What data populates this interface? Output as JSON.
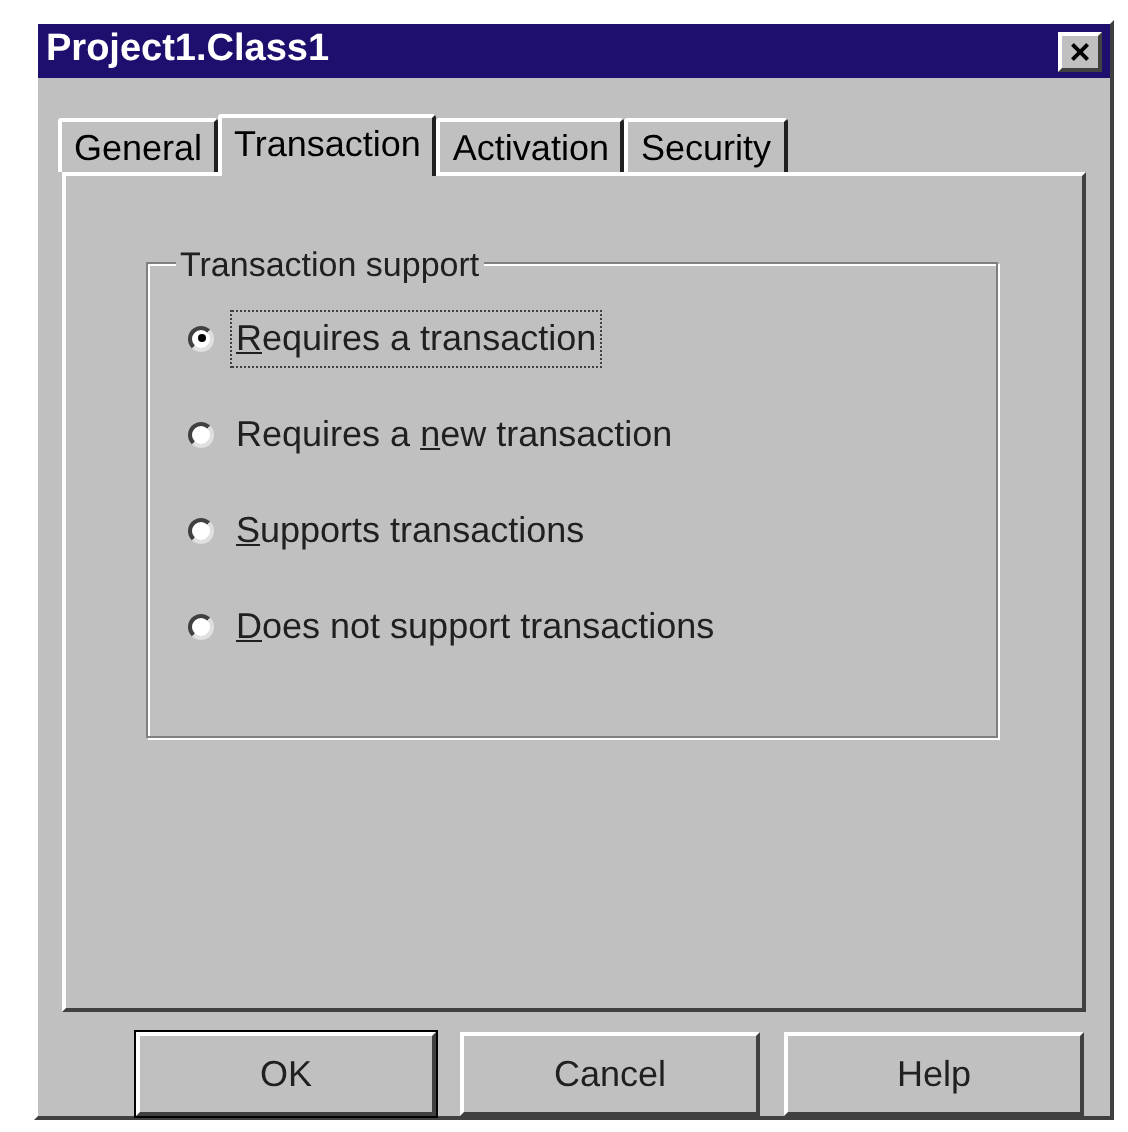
{
  "window": {
    "title": "Project1.Class1",
    "close_glyph": "×"
  },
  "tabs": [
    {
      "label": "General",
      "selected": false
    },
    {
      "label": "Transaction",
      "selected": true
    },
    {
      "label": "Activation",
      "selected": false
    },
    {
      "label": "Security",
      "selected": false
    }
  ],
  "group": {
    "title": "Transaction support",
    "options": [
      {
        "key": "R",
        "after": "equires a transaction",
        "selected": true,
        "focused": true
      },
      {
        "before": "Requires a ",
        "key": "n",
        "after": "ew transaction",
        "selected": false,
        "focused": false
      },
      {
        "key": "S",
        "after": "upports transactions",
        "selected": false,
        "focused": false
      },
      {
        "key": "D",
        "after": "oes not support transactions",
        "selected": false,
        "focused": false
      }
    ]
  },
  "buttons": [
    {
      "label": "OK",
      "default": true
    },
    {
      "label": "Cancel",
      "default": false
    },
    {
      "label": "Help",
      "default": false
    }
  ]
}
